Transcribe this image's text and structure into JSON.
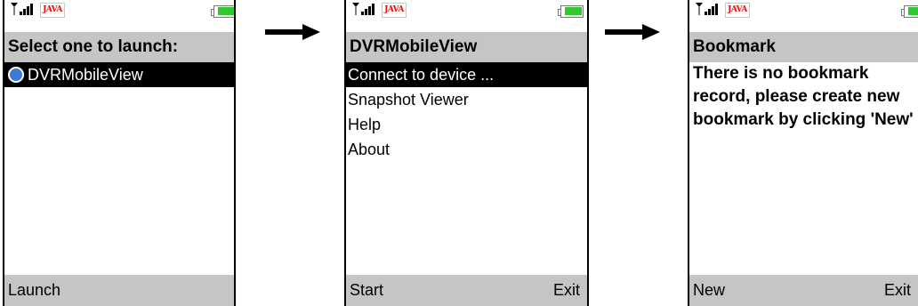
{
  "colors": {
    "accent_bar": "#c5c5c5",
    "selection": "#000000",
    "battery": "#2fc82f",
    "java_logo": "#dd1111"
  },
  "status": {
    "java_label": "JAVA"
  },
  "icons": [
    "signal-icon",
    "java-logo",
    "battery-icon",
    "arrow-right-icon",
    "app-icon"
  ],
  "screens": [
    {
      "title": "Select one to launch:",
      "items": [
        {
          "label": "DVRMobileView",
          "selected": true
        }
      ],
      "soft_left": "Launch",
      "soft_right": ""
    },
    {
      "title": "DVRMobileView",
      "items": [
        {
          "label": "Connect to device ...",
          "selected": true
        },
        {
          "label": "Snapshot Viewer",
          "selected": false
        },
        {
          "label": "Help",
          "selected": false
        },
        {
          "label": "About",
          "selected": false
        }
      ],
      "soft_left": "Start",
      "soft_right": "Exit"
    },
    {
      "title": "Bookmark",
      "message": "There is no bookmark record, please create new bookmark by clicking 'New'",
      "soft_left": "New",
      "soft_right": "Exit"
    }
  ]
}
